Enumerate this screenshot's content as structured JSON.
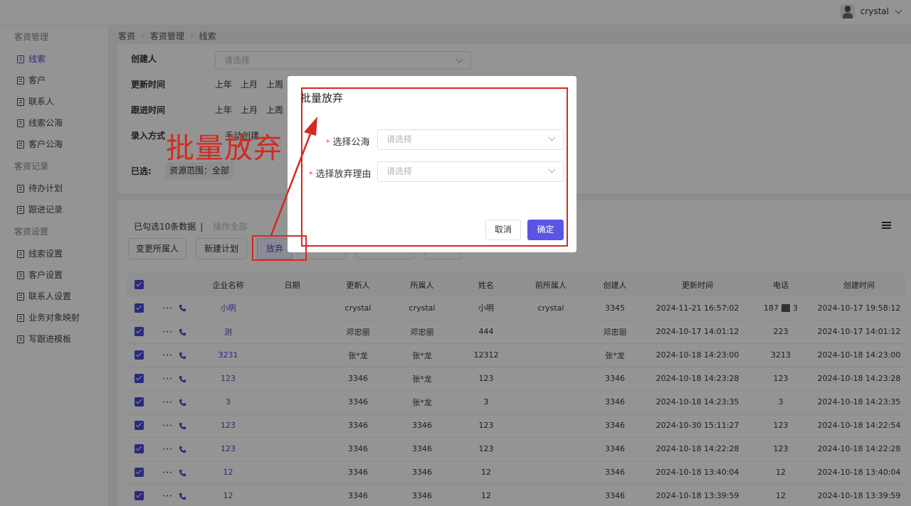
{
  "header": {
    "username": "crystal"
  },
  "sidebar": {
    "groups": [
      {
        "title": "客资管理",
        "items": [
          {
            "label": "线索"
          },
          {
            "label": "客户"
          },
          {
            "label": "联系人"
          },
          {
            "label": "线索公海"
          },
          {
            "label": "客户公海"
          }
        ]
      },
      {
        "title": "客资记录",
        "items": [
          {
            "label": "待办计划"
          },
          {
            "label": "跟进记录"
          }
        ]
      },
      {
        "title": "客资设置",
        "items": [
          {
            "label": "线索设置"
          },
          {
            "label": "客户设置"
          },
          {
            "label": "联系人设置"
          },
          {
            "label": "业务对象映射"
          },
          {
            "label": "写跟进模板"
          }
        ]
      }
    ]
  },
  "breadcrumb": [
    "客资",
    "客资管理",
    "线索"
  ],
  "filters": {
    "creator_label": "创建人",
    "creator_placeholder": "请选择",
    "update_time_label": "更新时间",
    "followup_time_label": "跟进时间",
    "time_options": [
      "上年",
      "上月",
      "上周"
    ],
    "entry_method_label": "录入方式",
    "entry_method_value": "手动创建",
    "selected_label": "已选:",
    "selected_tag": "资源范围：全部"
  },
  "list": {
    "selection_info": "已勾选10条数据",
    "separator": "|",
    "operate_all": "操作全部",
    "buttons": {
      "change_owner": "变更所属人",
      "new_plan": "新建计划",
      "abandon": "放弃"
    },
    "columns": [
      "企业名称",
      "日期",
      "更新人",
      "所属人",
      "姓名",
      "前所属人",
      "创建人",
      "更新时间",
      "电话",
      "创建时间"
    ],
    "rows": [
      {
        "company": "小明",
        "date": "",
        "updater": "crystal",
        "owner": "crystal",
        "name": "小明",
        "prev_owner": "crystal",
        "creator": "3345",
        "updated": "2024-11-21 16:57:02",
        "phone": "187",
        "phone_tail": "3",
        "created": "2024-10-17 19:58:12"
      },
      {
        "company": "测",
        "date": "",
        "updater": "邓忠丽",
        "owner": "邓忠丽",
        "name": "444",
        "prev_owner": "",
        "creator": "邓忠丽",
        "updated": "2024-10-17 14:01:12",
        "phone": "223",
        "phone_tail": "",
        "created": "2024-10-17 14:01:12"
      },
      {
        "company": "3231",
        "date": "",
        "updater": "张*龙",
        "owner": "张*龙",
        "name": "12312",
        "prev_owner": "",
        "creator": "张*龙",
        "updated": "2024-10-18 14:23:00",
        "phone": "3213",
        "phone_tail": "",
        "created": "2024-10-18 14:23:00"
      },
      {
        "company": "123",
        "date": "",
        "updater": "3346",
        "owner": "张*龙",
        "name": "123",
        "prev_owner": "",
        "creator": "3346",
        "updated": "2024-10-18 14:23:28",
        "phone": "123",
        "phone_tail": "",
        "created": "2024-10-18 14:23:28"
      },
      {
        "company": "3",
        "date": "",
        "updater": "3346",
        "owner": "张*龙",
        "name": "3",
        "prev_owner": "",
        "creator": "3346",
        "updated": "2024-10-18 14:23:35",
        "phone": "3",
        "phone_tail": "",
        "created": "2024-10-18 14:23:35"
      },
      {
        "company": "123",
        "date": "",
        "updater": "3346",
        "owner": "3346",
        "name": "123",
        "prev_owner": "",
        "creator": "3346",
        "updated": "2024-10-30 15:11:27",
        "phone": "123",
        "phone_tail": "",
        "created": "2024-10-18 14:22:54"
      },
      {
        "company": "123",
        "date": "",
        "updater": "3346",
        "owner": "3346",
        "name": "123",
        "prev_owner": "",
        "creator": "3346",
        "updated": "2024-10-18 14:22:28",
        "phone": "123",
        "phone_tail": "",
        "created": "2024-10-18 14:22:28"
      },
      {
        "company": "12",
        "date": "",
        "updater": "3346",
        "owner": "3346",
        "name": "12",
        "prev_owner": "",
        "creator": "3346",
        "updated": "2024-10-18 13:40:04",
        "phone": "12",
        "phone_tail": "",
        "created": "2024-10-18 13:40:04"
      },
      {
        "company": "12",
        "date": "",
        "updater": "3346",
        "owner": "3346",
        "name": "12",
        "prev_owner": "",
        "creator": "3346",
        "updated": "2024-10-18 13:39:59",
        "phone": "12",
        "phone_tail": "",
        "created": "2024-10-18 13:39:59"
      }
    ]
  },
  "modal": {
    "title": "批量放弃",
    "sea_label": "选择公海",
    "sea_placeholder": "请选择",
    "reason_label": "选择放弃理由",
    "reason_placeholder": "请选择",
    "required_mark": "*",
    "cancel": "取消",
    "confirm": "确定"
  },
  "annotation": {
    "text": "批量放弃",
    "color": "#d42a1f"
  },
  "colors": {
    "accent": "#4b48d8",
    "primary_button": "#5b54e6"
  }
}
